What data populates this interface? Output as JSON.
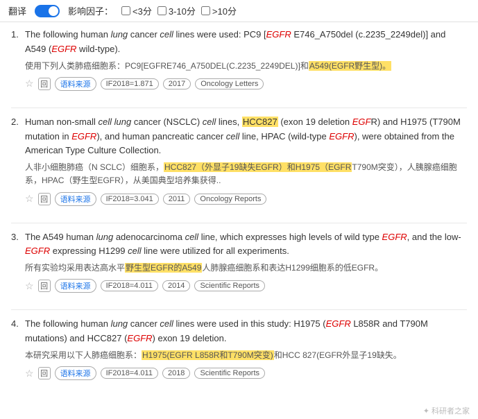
{
  "topbar": {
    "translate_label": "翻译",
    "impact_label": "影响因子：",
    "filter1_label": "<3分",
    "filter2_label": "3-10分",
    "filter3_label": ">10分"
  },
  "results": [
    {
      "number": "1.",
      "en_parts": [
        {
          "text": "The following human ",
          "type": "normal"
        },
        {
          "text": "lung",
          "type": "italic"
        },
        {
          "text": " cancer ",
          "type": "normal"
        },
        {
          "text": "cell",
          "type": "italic"
        },
        {
          "text": " lines were used: PC9 [",
          "type": "normal"
        },
        {
          "text": "EGFR",
          "type": "italic-red"
        },
        {
          "text": " E746_A750del (c.2235_2249del)] and A549 (",
          "type": "normal"
        },
        {
          "text": "EGFR",
          "type": "italic-red"
        },
        {
          "text": " wild-type).",
          "type": "normal"
        }
      ],
      "zh_parts": [
        {
          "text": "使用下列人类肺癌细胞系：PC9[EGFRE746_A750DEL(C.2235_2249DEL)]和",
          "type": "normal"
        },
        {
          "text": "A549(EGFR野生型)。",
          "type": "highlight"
        }
      ],
      "meta": {
        "if_year": "IF2018=1.871",
        "year": "2017",
        "journal": "Oncology Letters"
      }
    },
    {
      "number": "2.",
      "en_parts": [
        {
          "text": "Human non-small ",
          "type": "normal"
        },
        {
          "text": "cell lung",
          "type": "italic"
        },
        {
          "text": " cancer (NSCLC) ",
          "type": "normal"
        },
        {
          "text": "cell",
          "type": "italic"
        },
        {
          "text": " lines, ",
          "type": "normal"
        },
        {
          "text": "HCC827",
          "type": "highlight"
        },
        {
          "text": " (exon 19 deletion ",
          "type": "normal"
        },
        {
          "text": "EGF",
          "type": "italic-red"
        },
        {
          "text": "R) and H1975 (T790M mutation in ",
          "type": "normal"
        },
        {
          "text": "EGFR",
          "type": "italic-red"
        },
        {
          "text": "), and human pancreatic cancer ",
          "type": "normal"
        },
        {
          "text": "cell",
          "type": "italic"
        },
        {
          "text": " line, HPAC (wild-type ",
          "type": "normal"
        },
        {
          "text": "EGFR",
          "type": "italic-red"
        },
        {
          "text": "), were obtained from the American Type Culture Collection.",
          "type": "normal"
        }
      ],
      "zh_parts": [
        {
          "text": "人非小细胞肺癌（N SCLC）细胞系，",
          "type": "normal"
        },
        {
          "text": "HCC827（外显子19缺失EGFR）和H1975（EGFR",
          "type": "highlight"
        },
        {
          "text": "T790M突变），人胰腺癌细胞系，HPAC（野生型EGFR），从美国典型培养集获得..",
          "type": "normal"
        }
      ],
      "meta": {
        "if_year": "IF2018=3.041",
        "year": "2011",
        "journal": "Oncology Reports"
      }
    },
    {
      "number": "3.",
      "en_parts": [
        {
          "text": "The A549 human ",
          "type": "normal"
        },
        {
          "text": "lung",
          "type": "italic"
        },
        {
          "text": " adenocarcinoma ",
          "type": "normal"
        },
        {
          "text": "cell",
          "type": "italic"
        },
        {
          "text": " line, which expresses high levels of wild type ",
          "type": "normal"
        },
        {
          "text": "EGFR",
          "type": "italic-red"
        },
        {
          "text": ", and the low-",
          "type": "normal"
        },
        {
          "text": "EGFR",
          "type": "italic-red"
        },
        {
          "text": " expressing H1299 ",
          "type": "normal"
        },
        {
          "text": "cell",
          "type": "italic"
        },
        {
          "text": " line were utilized for all experiments.",
          "type": "normal"
        }
      ],
      "zh_parts": [
        {
          "text": "所有实验均采用表达高水平",
          "type": "normal"
        },
        {
          "text": "野生型EGFR的A549",
          "type": "highlight"
        },
        {
          "text": "人肺腺癌细胞系和表达H1299细胞系的低EGFR。",
          "type": "normal"
        }
      ],
      "meta": {
        "if_year": "IF2018=4.011",
        "year": "2014",
        "journal": "Scientific Reports"
      }
    },
    {
      "number": "4.",
      "en_parts": [
        {
          "text": "The following human ",
          "type": "normal"
        },
        {
          "text": "lung",
          "type": "italic"
        },
        {
          "text": " cancer ",
          "type": "normal"
        },
        {
          "text": "cell",
          "type": "italic"
        },
        {
          "text": " lines were used in this study: H1975 (",
          "type": "normal"
        },
        {
          "text": "EGFR",
          "type": "italic-red"
        },
        {
          "text": " L858R and T790M mutations) and HCC827 (",
          "type": "normal"
        },
        {
          "text": "EGFR",
          "type": "italic-red"
        },
        {
          "text": ") exon 19 deletion.",
          "type": "normal"
        }
      ],
      "zh_parts": [
        {
          "text": "本研究采用以下人肺癌细胞系：",
          "type": "normal"
        },
        {
          "text": "H1975(EGFR L858R和T790M突变)",
          "type": "highlight"
        },
        {
          "text": "和HCC 827(EGFR外显子19缺失。",
          "type": "normal"
        }
      ],
      "meta": {
        "if_year": "IF2018=4.011",
        "year": "2018",
        "journal": "Scientific Reports"
      }
    }
  ],
  "watermark": "科研者之家"
}
